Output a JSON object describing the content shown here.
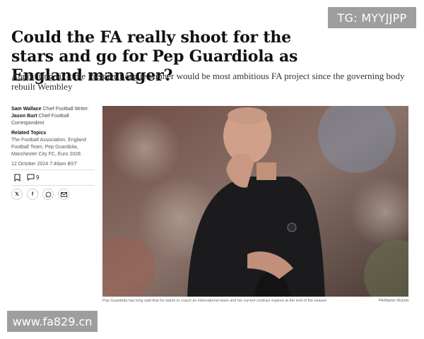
{
  "watermarks": {
    "top": "TG: MYYJJPP",
    "bottom": "www.fa829.cn"
  },
  "article": {
    "headline": "Could the FA really shoot for the stars and go for Pep Guardiola as England manager?",
    "standfirst": "Appointing six-time Premier League winner would be most ambitious FA project since the governing body rebuilt Wembley",
    "authors": [
      {
        "name": "Sam Wallace",
        "role": "Chief Football Writer."
      },
      {
        "name": "Jason Burt",
        "role": "Chief Football Correspondent"
      }
    ],
    "related_heading": "Related Topics",
    "related_topics": "The Football Association, England Football Team, Pep Guardiola, Manchester City FC, Euro 2028",
    "date": "12 October 2024 7:48am BST",
    "comments_count": "9",
    "caption": "Pep Guardiola has long said that he wants to coach an international team and his current contract expires at the end of the season",
    "credit": "PA/Martin Rickett"
  },
  "icons": {
    "bookmark": "bookmark-icon",
    "comment": "comment-icon",
    "x": "x-icon",
    "facebook": "facebook-icon",
    "whatsapp": "whatsapp-icon",
    "email": "email-icon"
  },
  "social_glyphs": {
    "x": "𝕏",
    "facebook": "f"
  },
  "colors": {
    "text": "#111111",
    "meta": "#555555",
    "watermark_bg": "#9e9e9e"
  }
}
